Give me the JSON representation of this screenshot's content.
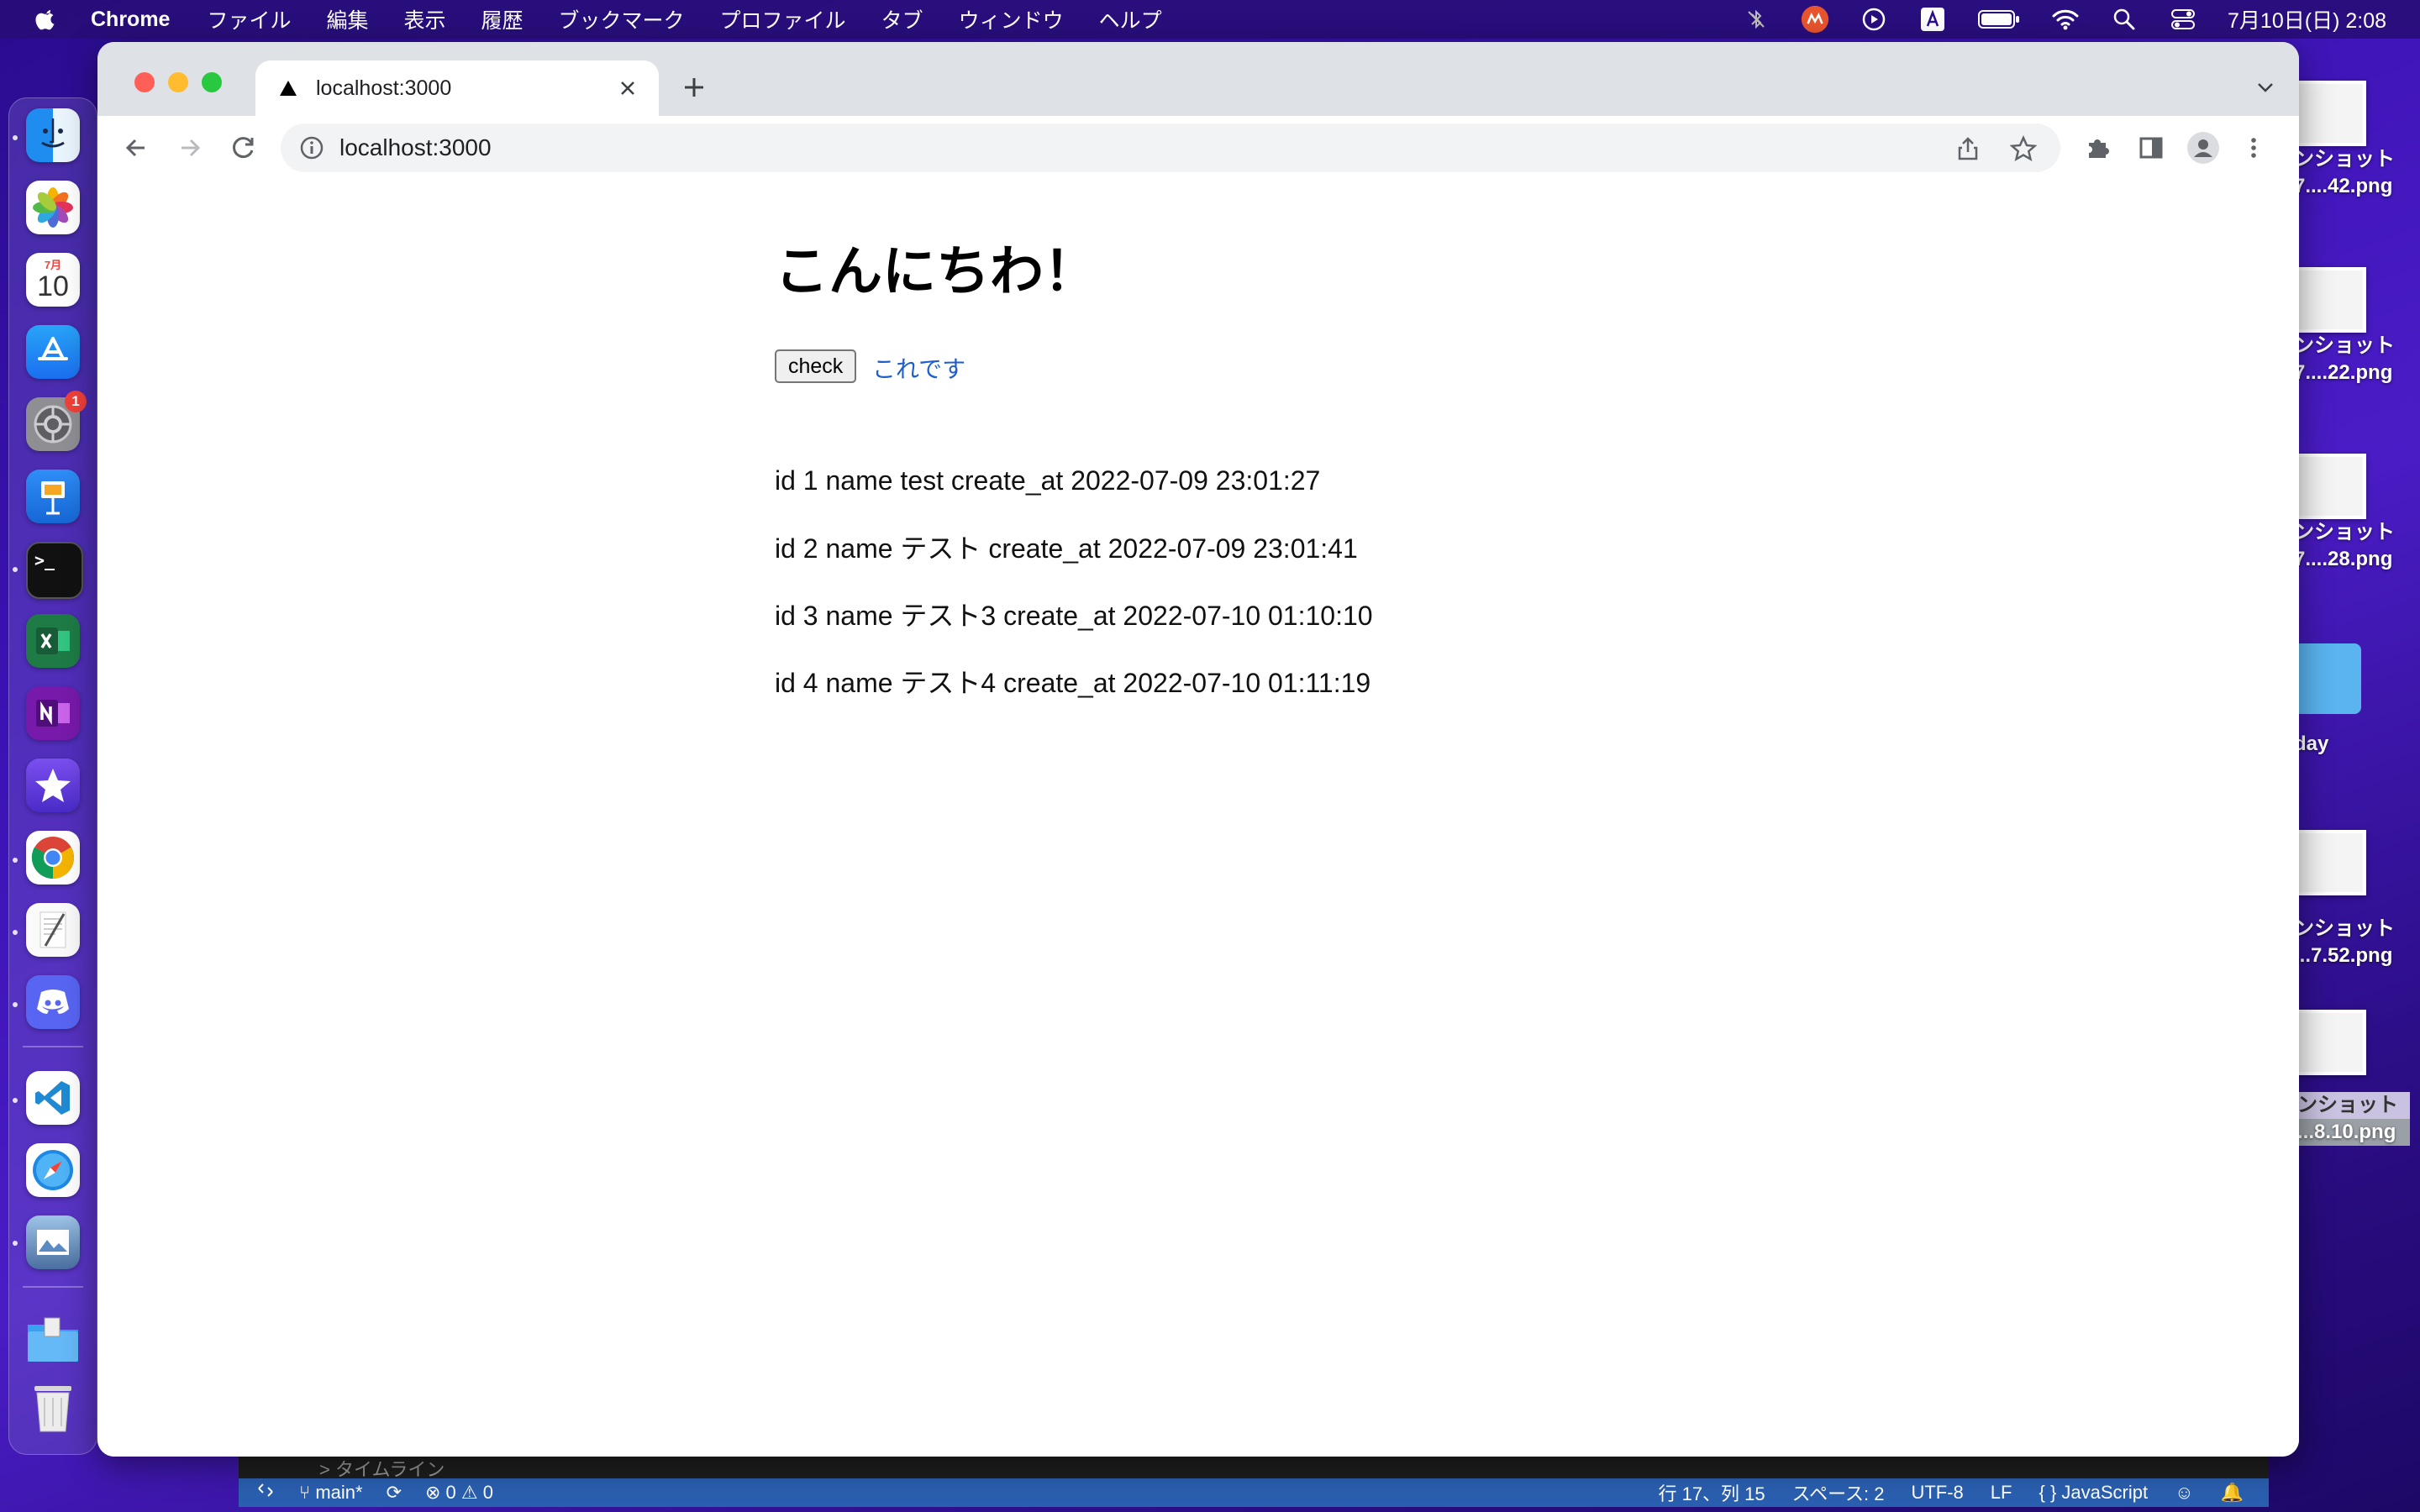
{
  "menubar": {
    "app_name": "Chrome",
    "items": [
      "ファイル",
      "編集",
      "表示",
      "履歴",
      "ブックマーク",
      "プロファイル",
      "タブ",
      "ウィンドウ",
      "ヘルプ"
    ],
    "clock": "7月10日(日) 2:08",
    "status_icons": [
      "bluetooth-muted-icon",
      "app-m-icon",
      "play-icon",
      "input-a-icon",
      "battery-icon",
      "wifi-icon",
      "spotlight-search-icon",
      "control-center-icon"
    ]
  },
  "dock": {
    "calendar_month": "7月",
    "calendar_day": "10",
    "settings_badge": "1",
    "apps": [
      "finder",
      "photos",
      "calendar",
      "app-store",
      "system-preferences",
      "keynote",
      "terminal",
      "excel",
      "onenote",
      "imovie",
      "chrome",
      "textedit",
      "discord",
      "vscode",
      "safari",
      "preview",
      "downloads",
      "trash"
    ]
  },
  "desktop": {
    "files": [
      {
        "line1": "ンショット",
        "line2": "7....42.png"
      },
      {
        "line1": "ンショット",
        "line2": "7....22.png"
      },
      {
        "line1": "ンショット",
        "line2": "7....28.png"
      },
      {
        "line1": "day",
        "line2": ""
      },
      {
        "line1": "ンショット",
        "line2": "...7.52.png"
      },
      {
        "line1": "ンショット",
        "line2": "...8.10.png"
      }
    ]
  },
  "vscode": {
    "timeline": "> タイムライン",
    "branch": "main*",
    "problems": "⊗ 0 ⚠ 0",
    "position": "行 17、列 15",
    "spaces": "スペース: 2",
    "encoding": "UTF-8",
    "eol": "LF",
    "language": "{ } JavaScript"
  },
  "browser": {
    "tab_title": "localhost:3000",
    "url": "localhost:3000"
  },
  "page": {
    "heading": "こんにちわ！",
    "check_button": "check",
    "link_text": "これです",
    "records": [
      "id 1 name test create_at 2022-07-09 23:01:27",
      "id 2 name テスト create_at 2022-07-09 23:01:41",
      "id 3 name テスト3 create_at 2022-07-10 01:10:10",
      "id 4 name テスト4 create_at 2022-07-10 01:11:19"
    ]
  },
  "colors": {
    "link": "#1f5fc9",
    "tabbar": "#dee1e6",
    "vscode_status": "#2a5fb0"
  }
}
